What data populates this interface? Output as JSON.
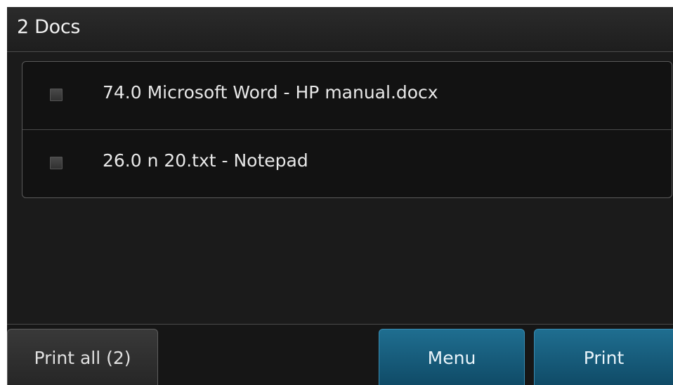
{
  "header": {
    "title": "2 Docs"
  },
  "documents": [
    {
      "label": "74.0 Microsoft Word - HP manual.docx",
      "checked": false
    },
    {
      "label": "26.0 n 20.txt - Notepad",
      "checked": false
    }
  ],
  "footer": {
    "print_all_label": "Print all (2)",
    "menu_label": "Menu",
    "print_label": "Print"
  },
  "colors": {
    "background": "#1b1b1b",
    "accent_button": "#1a6485",
    "neutral_button": "#2f2f2f"
  }
}
